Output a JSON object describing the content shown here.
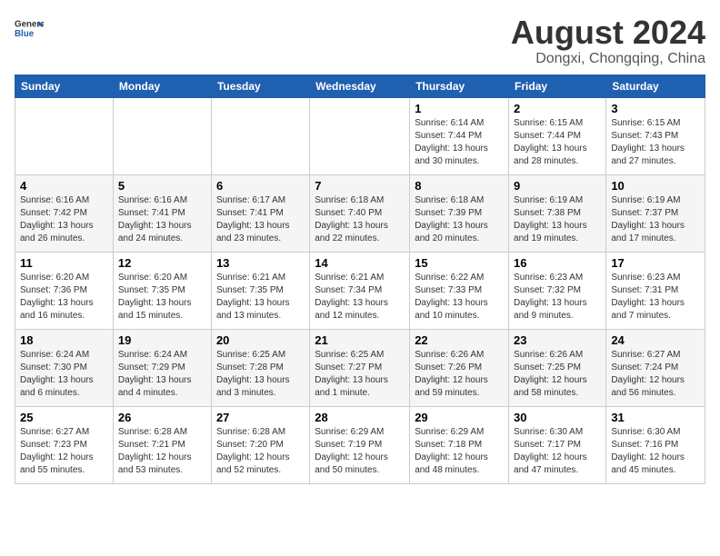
{
  "header": {
    "logo_line1": "General",
    "logo_line2": "Blue",
    "month_year": "August 2024",
    "location": "Dongxi, Chongqing, China"
  },
  "weekdays": [
    "Sunday",
    "Monday",
    "Tuesday",
    "Wednesday",
    "Thursday",
    "Friday",
    "Saturday"
  ],
  "weeks": [
    [
      {
        "day": "",
        "info": ""
      },
      {
        "day": "",
        "info": ""
      },
      {
        "day": "",
        "info": ""
      },
      {
        "day": "",
        "info": ""
      },
      {
        "day": "1",
        "info": "Sunrise: 6:14 AM\nSunset: 7:44 PM\nDaylight: 13 hours\nand 30 minutes."
      },
      {
        "day": "2",
        "info": "Sunrise: 6:15 AM\nSunset: 7:44 PM\nDaylight: 13 hours\nand 28 minutes."
      },
      {
        "day": "3",
        "info": "Sunrise: 6:15 AM\nSunset: 7:43 PM\nDaylight: 13 hours\nand 27 minutes."
      }
    ],
    [
      {
        "day": "4",
        "info": "Sunrise: 6:16 AM\nSunset: 7:42 PM\nDaylight: 13 hours\nand 26 minutes."
      },
      {
        "day": "5",
        "info": "Sunrise: 6:16 AM\nSunset: 7:41 PM\nDaylight: 13 hours\nand 24 minutes."
      },
      {
        "day": "6",
        "info": "Sunrise: 6:17 AM\nSunset: 7:41 PM\nDaylight: 13 hours\nand 23 minutes."
      },
      {
        "day": "7",
        "info": "Sunrise: 6:18 AM\nSunset: 7:40 PM\nDaylight: 13 hours\nand 22 minutes."
      },
      {
        "day": "8",
        "info": "Sunrise: 6:18 AM\nSunset: 7:39 PM\nDaylight: 13 hours\nand 20 minutes."
      },
      {
        "day": "9",
        "info": "Sunrise: 6:19 AM\nSunset: 7:38 PM\nDaylight: 13 hours\nand 19 minutes."
      },
      {
        "day": "10",
        "info": "Sunrise: 6:19 AM\nSunset: 7:37 PM\nDaylight: 13 hours\nand 17 minutes."
      }
    ],
    [
      {
        "day": "11",
        "info": "Sunrise: 6:20 AM\nSunset: 7:36 PM\nDaylight: 13 hours\nand 16 minutes."
      },
      {
        "day": "12",
        "info": "Sunrise: 6:20 AM\nSunset: 7:35 PM\nDaylight: 13 hours\nand 15 minutes."
      },
      {
        "day": "13",
        "info": "Sunrise: 6:21 AM\nSunset: 7:35 PM\nDaylight: 13 hours\nand 13 minutes."
      },
      {
        "day": "14",
        "info": "Sunrise: 6:21 AM\nSunset: 7:34 PM\nDaylight: 13 hours\nand 12 minutes."
      },
      {
        "day": "15",
        "info": "Sunrise: 6:22 AM\nSunset: 7:33 PM\nDaylight: 13 hours\nand 10 minutes."
      },
      {
        "day": "16",
        "info": "Sunrise: 6:23 AM\nSunset: 7:32 PM\nDaylight: 13 hours\nand 9 minutes."
      },
      {
        "day": "17",
        "info": "Sunrise: 6:23 AM\nSunset: 7:31 PM\nDaylight: 13 hours\nand 7 minutes."
      }
    ],
    [
      {
        "day": "18",
        "info": "Sunrise: 6:24 AM\nSunset: 7:30 PM\nDaylight: 13 hours\nand 6 minutes."
      },
      {
        "day": "19",
        "info": "Sunrise: 6:24 AM\nSunset: 7:29 PM\nDaylight: 13 hours\nand 4 minutes."
      },
      {
        "day": "20",
        "info": "Sunrise: 6:25 AM\nSunset: 7:28 PM\nDaylight: 13 hours\nand 3 minutes."
      },
      {
        "day": "21",
        "info": "Sunrise: 6:25 AM\nSunset: 7:27 PM\nDaylight: 13 hours\nand 1 minute."
      },
      {
        "day": "22",
        "info": "Sunrise: 6:26 AM\nSunset: 7:26 PM\nDaylight: 12 hours\nand 59 minutes."
      },
      {
        "day": "23",
        "info": "Sunrise: 6:26 AM\nSunset: 7:25 PM\nDaylight: 12 hours\nand 58 minutes."
      },
      {
        "day": "24",
        "info": "Sunrise: 6:27 AM\nSunset: 7:24 PM\nDaylight: 12 hours\nand 56 minutes."
      }
    ],
    [
      {
        "day": "25",
        "info": "Sunrise: 6:27 AM\nSunset: 7:23 PM\nDaylight: 12 hours\nand 55 minutes."
      },
      {
        "day": "26",
        "info": "Sunrise: 6:28 AM\nSunset: 7:21 PM\nDaylight: 12 hours\nand 53 minutes."
      },
      {
        "day": "27",
        "info": "Sunrise: 6:28 AM\nSunset: 7:20 PM\nDaylight: 12 hours\nand 52 minutes."
      },
      {
        "day": "28",
        "info": "Sunrise: 6:29 AM\nSunset: 7:19 PM\nDaylight: 12 hours\nand 50 minutes."
      },
      {
        "day": "29",
        "info": "Sunrise: 6:29 AM\nSunset: 7:18 PM\nDaylight: 12 hours\nand 48 minutes."
      },
      {
        "day": "30",
        "info": "Sunrise: 6:30 AM\nSunset: 7:17 PM\nDaylight: 12 hours\nand 47 minutes."
      },
      {
        "day": "31",
        "info": "Sunrise: 6:30 AM\nSunset: 7:16 PM\nDaylight: 12 hours\nand 45 minutes."
      }
    ]
  ]
}
